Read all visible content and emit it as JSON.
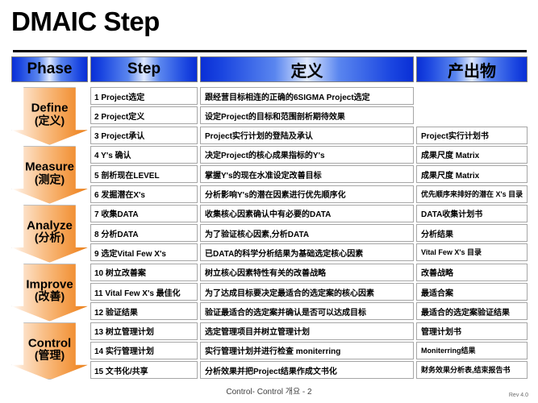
{
  "slide": {
    "title": "DMAIC Step",
    "footer_center": "Control- Control 개요 - 2",
    "footer_rev": "Rev 4.0"
  },
  "header": {
    "phase": "Phase",
    "step": "Step",
    "definition": "定义",
    "output": "产出物"
  },
  "phases": [
    {
      "en": "Define",
      "cn": "(定义)"
    },
    {
      "en": "Measure",
      "cn": "(测定)"
    },
    {
      "en": "Analyze",
      "cn": "(分析)"
    },
    {
      "en": "Improve",
      "cn": "(改善)"
    },
    {
      "en": "Control",
      "cn": "(管理)"
    }
  ],
  "rows": [
    {
      "step": "1 Project选定",
      "definition": "跟经营目标相连的正确的6SIGMA Project选定",
      "output": ""
    },
    {
      "step": "2 Project定义",
      "definition": "设定Project的目标和范围剖析期待效果",
      "output": ""
    },
    {
      "step": "3 Project承认",
      "definition": "Project实行计划的登陆及承认",
      "output": "Project实行计划书"
    },
    {
      "step": "4 Y's 确认",
      "definition": "决定Project的核心成果指标的Y's",
      "output": "成果尺度 Matrix"
    },
    {
      "step": "5 剖析现在LEVEL",
      "definition": "掌握Y's的现在水准设定改善目标",
      "output": "成果尺度 Matrix"
    },
    {
      "step": "6 发掘潜在X's",
      "definition": "分析影响Y's的潜在因素进行优先顺序化",
      "output": "优先顺序来排好的潜在 X's 目录"
    },
    {
      "step": "7 收集DATA",
      "definition": "收集核心因素确认中有必要的DATA",
      "output": "DATA收集计划书"
    },
    {
      "step": "8 分析DATA",
      "definition": "为了验证核心因素,分析DATA",
      "output": "分析结果"
    },
    {
      "step": "9 选定Vital Few X's",
      "definition": "已DATA的科学分析结果为基础选定核心因素",
      "output": "Vital Few X's 目录"
    },
    {
      "step": "10 树立改善案",
      "definition": "树立核心因素特性有关的改善战略",
      "output": "改善战略"
    },
    {
      "step": "11 Vital Few X's 最佳化",
      "definition": "为了达成目标要决定最适合的选定案的核心因素",
      "output": "最适合案"
    },
    {
      "step": "12 验证结果",
      "definition": "验证最适合的选定案并确认是否可以达成目标",
      "output": "最适合的选定案验证结果"
    },
    {
      "step": "13 树立管理计划",
      "definition": "选定管理项目并树立管理计划",
      "output": "管理计划书"
    },
    {
      "step": "14 实行管理计划",
      "definition": "实行管理计划并进行检查 moniterring",
      "output": "Moniterring结果"
    },
    {
      "step": "15 文书化/共享",
      "definition": "分析效果并把Project结果作成文书化",
      "output": "财务效果分析表,结束报告书"
    }
  ],
  "colors": {
    "header_blue_dark": "#0a2fd6",
    "header_blue_light": "#dfe9ff",
    "phase_orange_dark": "#e8821f",
    "phase_orange_light": "#fde4ce",
    "rule": "#000000",
    "cell_border": "#a6a6a6"
  }
}
